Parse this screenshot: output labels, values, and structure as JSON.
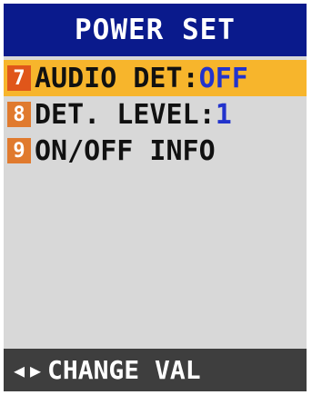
{
  "title": "POWER SET",
  "menu": [
    {
      "number": "7",
      "label": "AUDIO DET",
      "separator": ":",
      "value": "OFF",
      "selected": true
    },
    {
      "number": "8",
      "label": "DET. LEVEL",
      "separator": ":",
      "value": "1",
      "selected": false
    },
    {
      "number": "9",
      "label": "ON/OFF INFO",
      "separator": "",
      "value": "",
      "selected": false
    }
  ],
  "status_bar": {
    "left_arrow_icon": "◀",
    "right_arrow_icon": "▶",
    "text": "CHANGE VAL"
  },
  "colors": {
    "title_bg": "#0a1a8c",
    "selected_bg": "#f7b52c",
    "badge": "#e07a2e",
    "value_text": "#2233cc",
    "status_bg": "#3e3e3e",
    "screen_bg": "#d8d8d8"
  }
}
